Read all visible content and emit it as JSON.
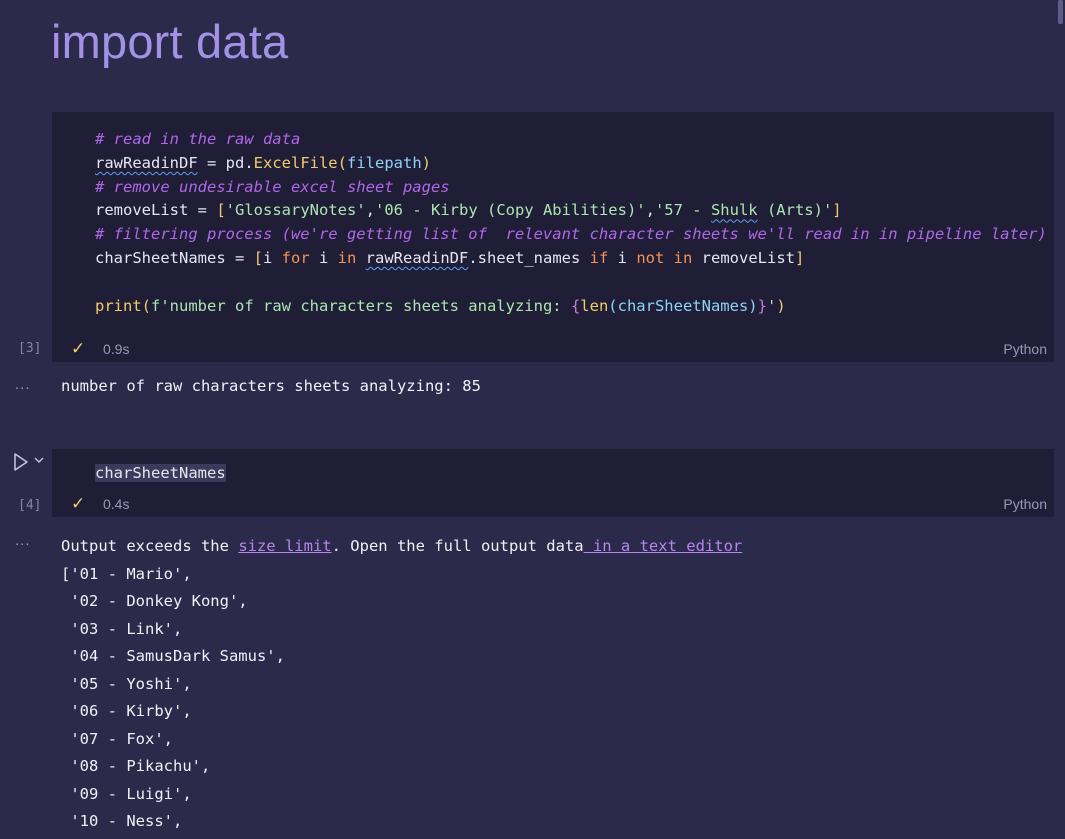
{
  "markdown": {
    "title": "import data"
  },
  "cell3": {
    "exec_count": "[3]",
    "code": {
      "l1": "# read in the raw data",
      "l2_var": "rawReadinDF",
      "l2_eq": " = pd.",
      "l2_fn": "ExcelFile",
      "l2_arg": "filepath",
      "l3": "# remove undesirable excel sheet pages",
      "l4_pre": "removeList = ",
      "l4_s1": "'GlossaryNotes'",
      "l4_s2": "'06 - Kirby (Copy Abilities)'",
      "l4_s3a": "'57 - ",
      "l4_s3b": "Shulk",
      "l4_s3c": " (Arts)'",
      "l5": "# filtering process (we're getting list of  relevant character sheets we'll read in in pipeline later)",
      "l6_a": "charSheetNames = ",
      "l6_b": "i ",
      "l6_for": "for",
      "l6_c": " i ",
      "l6_in": "in",
      "l6_var": "rawReadinDF",
      "l6_d": ".sheet_names ",
      "l6_if": "if",
      "l6_e": " i ",
      "l6_not": "not",
      "l6_in2": "in",
      "l6_f": " removeList",
      "l8_fn": "print",
      "l8_str": "f'number of raw characters sheets analyzing: ",
      "l8_len": "len",
      "l8_arg": "charSheetNames",
      "l8_end": "'"
    },
    "status": {
      "check": "✓",
      "time": "0.9s",
      "language": "Python"
    },
    "output": "number of raw characters sheets analyzing: 85"
  },
  "cell4": {
    "exec_count": "[4]",
    "code": "charSheetNames",
    "status": {
      "check": "✓",
      "time": "0.4s",
      "language": "Python"
    },
    "output": {
      "notice_pre": "Output exceeds the ",
      "size_limit_link": "size limit",
      "notice_mid": ". Open the full output data",
      "text_editor_link": " in a text editor",
      "lines": [
        "['01 - Mario',",
        " '02 - Donkey Kong',",
        " '03 - Link',",
        " '04 - SamusDark Samus',",
        " '05 - Yoshi',",
        " '06 - Kirby',",
        " '07 - Fox',",
        " '08 - Pikachu',",
        " '09 - Luigi',",
        " '10 - Ness',"
      ]
    }
  },
  "output_menu": "...",
  "colors": {
    "background": "#2b2a4a",
    "editor_background": "#1f1e36",
    "title": "#a391e6",
    "comment": "#b067e8",
    "string": "#abe6b0",
    "keyword": "#f49352",
    "function": "#f0cd6b",
    "link": "#b785ef"
  },
  "icons": [
    "run-icon",
    "chevron-down-icon",
    "checkmark-icon",
    "ellipsis-icon"
  ]
}
